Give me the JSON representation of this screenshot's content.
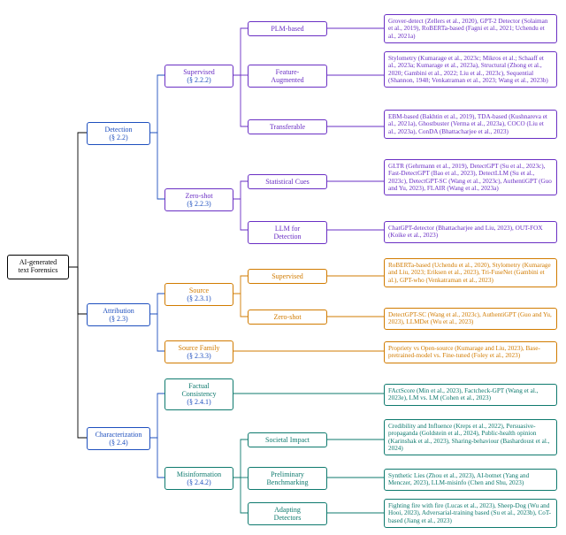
{
  "root": {
    "label": "AI-generated\ntext Forensics"
  },
  "l1": {
    "detection": {
      "label": "Detection",
      "section": "(§ 2.2)"
    },
    "attribution": {
      "label": "Attribution",
      "section": "(§ 2.3)"
    },
    "characterization": {
      "label": "Characterization",
      "section": "(§ 2.4)"
    }
  },
  "l2": {
    "supervised": {
      "label": "Supervised",
      "section": "(§ 2.2.2)"
    },
    "zeroshot_det": {
      "label": "Zero-shot",
      "section": "(§ 2.2.3)"
    },
    "source": {
      "label": "Source",
      "section": "(§ 2.3.1)"
    },
    "source_family": {
      "label": "Source Family",
      "section": "(§ 2.3.3)"
    },
    "factual": {
      "label": "Factual\nConsistency",
      "section": "(§ 2.4.1)"
    },
    "misinfo": {
      "label": "Misinformation",
      "section": "(§ 2.4.2)"
    }
  },
  "l3": {
    "plm": "PLM-based",
    "feature": "Feature-\nAugmented",
    "transferable": "Transferable",
    "stat": "Statistical Cues",
    "llm_det": "LLM for\nDetection",
    "src_sup": "Supervised",
    "src_zero": "Zero-shot",
    "societal": "Societal Impact",
    "prelim": "Preliminary\nBenchmarking",
    "adapting": "Adapting\nDetectors"
  },
  "leaves": {
    "plm": "Grover-detect (Zellers et al., 2020), GPT-2 Detector (Solaiman et al., 2019), RoBERTa-based (Fagni et al., 2021; Uchendu et al., 2021a)",
    "feature": "Stylometry (Kumarage et al., 2023c; Mikros et al.; Schaaff et al., 2023a; Kumarage et al., 2023a), Structural (Zhong et al., 2020; Gambini et al., 2022; Liu et al., 2023c), Sequential (Shannon, 1948; Venkatraman et al., 2023; Wang et al., 2023b)",
    "transferable": "EBM-based (Bakhtin et al., 2019), TDA-based (Kushnareva et al., 2021a), Ghostbuster (Verma et al., 2023a), COCO (Liu et al., 2023a), ConDA (Bhattacharjee et al., 2023)",
    "stat": "GLTR (Gehrmann et al., 2019), DetectGPT (Su et al., 2023c), Fast-DetectGPT (Bao et al., 2023), DetectLLM (Su et al., 2023c), DetectGPT-SC (Wang et al., 2023c), AuthentiGPT (Guo and Yu, 2023), FLAIR (Wang et al., 2023a)",
    "llm_det": "ChatGPT-detector (Bhattacharjee and Liu, 2023), OUT-FOX (Koike et al., 2023)",
    "src_sup": "RoBERTa-based (Uchendu et al., 2020), Stylometry (Kumarage and Liu, 2023; Eriksen et al., 2023), Tri-FuseNet (Gambini et al.), GPT-who (Venkatraman et al., 2023)",
    "src_zero": "DetectGPT-SC (Wang et al., 2023c), AuthentiGPT (Guo and Yu, 2023), LLMDet (Wu et al., 2023)",
    "source_family": "Propriety vs Open-source (Kumarage and Liu, 2023), Base-pretrained-model vs. Fine-tuned (Foley et al., 2023)",
    "factual": "FActScore (Min et al., 2023), Factcheck-GPT (Wang et al., 2023e), LM vs. LM (Cohen et al., 2023)",
    "societal": "Credibility and Influence (Kreps et al., 2022), Persuasive-propaganda (Goldstein et al., 2024), Public-health opinion (Karinshak et al., 2023), Sharing-behaviour (Bashardoust et al., 2024)",
    "prelim": "Synthetic Lies (Zhou et al., 2023), AI-botnet (Yang and Menczer, 2023), LLM-misinfo (Chen and Shu, 2023)",
    "adapting": "Fighting fire with fire (Lucas et al., 2023), Sheep-Dog (Wu and Hooi, 2023), Adversarial-training based (Su et al., 2023b), CoT-based (Jiang et al., 2023)"
  },
  "chart_data": {
    "type": "tree",
    "root": "AI-generated text Forensics",
    "children": [
      {
        "name": "Detection",
        "section": "2.2",
        "color": "blue",
        "children": [
          {
            "name": "Supervised",
            "section": "2.2.2",
            "color": "purple",
            "children": [
              {
                "name": "PLM-based",
                "refs": [
                  "Grover-detect (Zellers et al., 2020)",
                  "GPT-2 Detector (Solaiman et al., 2019)",
                  "RoBERTa-based (Fagni et al., 2021; Uchendu et al., 2021a)"
                ]
              },
              {
                "name": "Feature-Augmented",
                "refs": [
                  "Stylometry (Kumarage et al., 2023c; Mikros et al.; Schaaff et al., 2023a; Kumarage et al., 2023a)",
                  "Structural (Zhong et al., 2020; Gambini et al., 2022; Liu et al., 2023c)",
                  "Sequential (Shannon, 1948; Venkatraman et al., 2023; Wang et al., 2023b)"
                ]
              },
              {
                "name": "Transferable",
                "refs": [
                  "EBM-based (Bakhtin et al., 2019)",
                  "TDA-based (Kushnareva et al., 2021a)",
                  "Ghostbuster (Verma et al., 2023a)",
                  "COCO (Liu et al., 2023a)",
                  "ConDA (Bhattacharjee et al., 2023)"
                ]
              }
            ]
          },
          {
            "name": "Zero-shot",
            "section": "2.2.3",
            "color": "purple",
            "children": [
              {
                "name": "Statistical Cues",
                "refs": [
                  "GLTR (Gehrmann et al., 2019)",
                  "DetectGPT (Su et al., 2023c)",
                  "Fast-DetectGPT (Bao et al., 2023)",
                  "DetectLLM (Su et al., 2023c)",
                  "DetectGPT-SC (Wang et al., 2023c)",
                  "AuthentiGPT (Guo and Yu, 2023)",
                  "FLAIR (Wang et al., 2023a)"
                ]
              },
              {
                "name": "LLM for Detection",
                "refs": [
                  "ChatGPT-detector (Bhattacharjee and Liu, 2023)",
                  "OUT-FOX (Koike et al., 2023)"
                ]
              }
            ]
          }
        ]
      },
      {
        "name": "Attribution",
        "section": "2.3",
        "color": "blue",
        "children": [
          {
            "name": "Source",
            "section": "2.3.1",
            "color": "orange",
            "children": [
              {
                "name": "Supervised",
                "refs": [
                  "RoBERTa-based (Uchendu et al., 2020)",
                  "Stylometry (Kumarage and Liu, 2023; Eriksen et al., 2023)",
                  "Tri-FuseNet (Gambini et al.)",
                  "GPT-who (Venkatraman et al., 2023)"
                ]
              },
              {
                "name": "Zero-shot",
                "refs": [
                  "DetectGPT-SC (Wang et al., 2023c)",
                  "AuthentiGPT (Guo and Yu, 2023)",
                  "LLMDet (Wu et al., 2023)"
                ]
              }
            ]
          },
          {
            "name": "Source Family",
            "section": "2.3.3",
            "color": "orange",
            "refs": [
              "Propriety vs Open-source (Kumarage and Liu, 2023)",
              "Base-pretrained-model vs. Fine-tuned (Foley et al., 2023)"
            ]
          }
        ]
      },
      {
        "name": "Characterization",
        "section": "2.4",
        "color": "blue",
        "children": [
          {
            "name": "Factual Consistency",
            "section": "2.4.1",
            "color": "teal",
            "refs": [
              "FActScore (Min et al., 2023)",
              "Factcheck-GPT (Wang et al., 2023e)",
              "LM vs. LM (Cohen et al., 2023)"
            ]
          },
          {
            "name": "Misinformation",
            "section": "2.4.2",
            "color": "teal",
            "children": [
              {
                "name": "Societal Impact",
                "refs": [
                  "Credibility and Influence (Kreps et al., 2022)",
                  "Persuasive-propaganda (Goldstein et al., 2024)",
                  "Public-health opinion (Karinshak et al., 2023)",
                  "Sharing-behaviour (Bashardoust et al., 2024)"
                ]
              },
              {
                "name": "Preliminary Benchmarking",
                "refs": [
                  "Synthetic Lies (Zhou et al., 2023)",
                  "AI-botnet (Yang and Menczer, 2023)",
                  "LLM-misinfo (Chen and Shu, 2023)"
                ]
              },
              {
                "name": "Adapting Detectors",
                "refs": [
                  "Fighting fire with fire (Lucas et al., 2023)",
                  "Sheep-Dog (Wu and Hooi, 2023)",
                  "Adversarial-training based (Su et al., 2023b)",
                  "CoT-based (Jiang et al., 2023)"
                ]
              }
            ]
          }
        ]
      }
    ]
  }
}
